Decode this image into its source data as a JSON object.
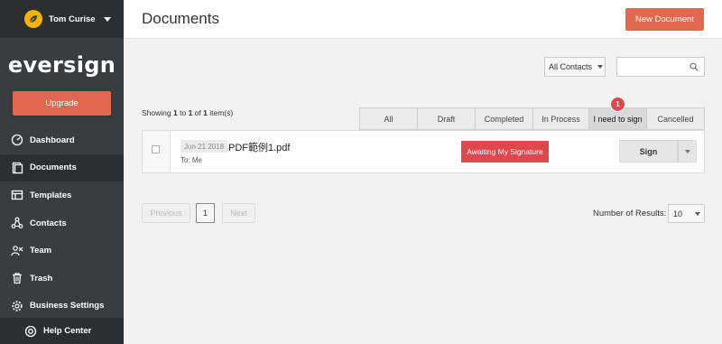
{
  "user": {
    "name": "Tom Curise"
  },
  "brand": {
    "logo_text": "eversign",
    "accent": "#e2674f",
    "danger": "#e0474c"
  },
  "sidebar": {
    "upgrade_label": "Upgrade",
    "items": [
      {
        "label": "Dashboard",
        "icon": "dashboard-icon"
      },
      {
        "label": "Documents",
        "icon": "documents-icon",
        "active": true
      },
      {
        "label": "Templates",
        "icon": "templates-icon"
      },
      {
        "label": "Contacts",
        "icon": "contacts-icon"
      },
      {
        "label": "Team",
        "icon": "team-icon"
      },
      {
        "label": "Trash",
        "icon": "trash-icon"
      },
      {
        "label": "Business Settings",
        "icon": "settings-icon"
      }
    ],
    "help_label": "Help Center"
  },
  "header": {
    "title": "Documents",
    "new_doc_label": "New Document"
  },
  "filters": {
    "contacts_selected": "All Contacts",
    "search_placeholder": ""
  },
  "showing": {
    "prefix": "Showing",
    "from": "1",
    "to_word": "to",
    "to": "1",
    "of_word": "of",
    "total": "1",
    "suffix": "item(s)"
  },
  "tabs": [
    {
      "label": "All"
    },
    {
      "label": "Draft"
    },
    {
      "label": "Completed"
    },
    {
      "label": "In Process"
    },
    {
      "label": "I need to sign",
      "active": true,
      "badge": "1"
    },
    {
      "label": "Cancelled"
    }
  ],
  "documents": [
    {
      "date": "Jun 21 2018",
      "name": "PDF範例1.pdf",
      "to": "To: Me",
      "status": "Awaiting My Signature",
      "action": "Sign"
    }
  ],
  "pagination": {
    "previous": "Previous",
    "current": "1",
    "next": "Next",
    "results_label": "Number of Results:",
    "results_value": "10"
  }
}
